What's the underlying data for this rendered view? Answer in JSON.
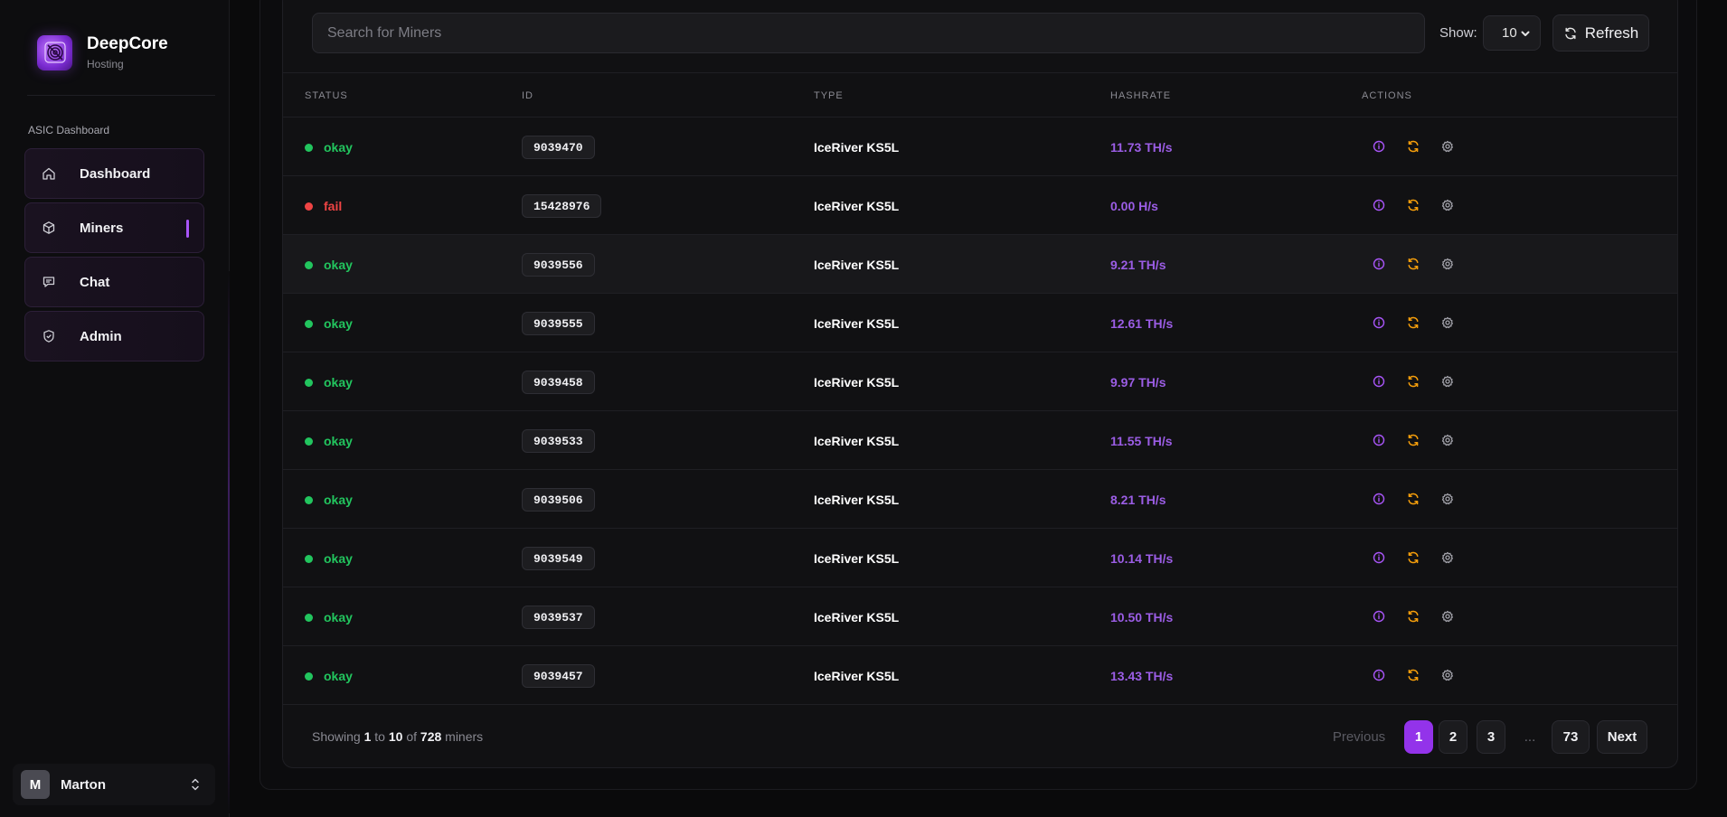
{
  "brand": {
    "name": "DeepCore",
    "subtitle": "Hosting"
  },
  "sidebar": {
    "section_label": "ASIC Dashboard",
    "items": [
      {
        "label": "Dashboard",
        "icon": "home-icon"
      },
      {
        "label": "Miners",
        "icon": "cube-icon",
        "active": true
      },
      {
        "label": "Chat",
        "icon": "chat-icon"
      },
      {
        "label": "Admin",
        "icon": "shield-icon"
      }
    ],
    "user": {
      "initial": "M",
      "name": "Marton"
    }
  },
  "toolbar": {
    "search_placeholder": "Search for Miners",
    "show_label": "Show:",
    "show_value": "10",
    "refresh_label": "Refresh"
  },
  "table": {
    "headers": {
      "status": "STATUS",
      "id": "ID",
      "type": "TYPE",
      "hashrate": "HASHRATE",
      "actions": "ACTIONS"
    },
    "rows": [
      {
        "status": "okay",
        "id": "9039470",
        "type": "IceRiver KS5L",
        "hashrate": "11.73 TH/s"
      },
      {
        "status": "fail",
        "id": "15428976",
        "type": "IceRiver KS5L",
        "hashrate": "0.00 H/s"
      },
      {
        "status": "okay",
        "id": "9039556",
        "type": "IceRiver KS5L",
        "hashrate": "9.21 TH/s"
      },
      {
        "status": "okay",
        "id": "9039555",
        "type": "IceRiver KS5L",
        "hashrate": "12.61 TH/s"
      },
      {
        "status": "okay",
        "id": "9039458",
        "type": "IceRiver KS5L",
        "hashrate": "9.97 TH/s"
      },
      {
        "status": "okay",
        "id": "9039533",
        "type": "IceRiver KS5L",
        "hashrate": "11.55 TH/s"
      },
      {
        "status": "okay",
        "id": "9039506",
        "type": "IceRiver KS5L",
        "hashrate": "8.21 TH/s"
      },
      {
        "status": "okay",
        "id": "9039549",
        "type": "IceRiver KS5L",
        "hashrate": "10.14 TH/s"
      },
      {
        "status": "okay",
        "id": "9039537",
        "type": "IceRiver KS5L",
        "hashrate": "10.50 TH/s"
      },
      {
        "status": "okay",
        "id": "9039457",
        "type": "IceRiver KS5L",
        "hashrate": "13.43 TH/s"
      }
    ]
  },
  "footer": {
    "showing_prefix": "Showing ",
    "from": "1",
    "to_word": " to ",
    "to": "10",
    "of_word": " of ",
    "total": "728",
    "suffix": " miners"
  },
  "pagination": {
    "previous": "Previous",
    "pages": [
      "1",
      "2",
      "3"
    ],
    "ellipsis": "...",
    "last": "73",
    "next": "Next",
    "current": "1"
  },
  "colors": {
    "accent": "#9333ea",
    "okay": "#22c55e",
    "fail": "#ef4444",
    "hashrate": "#9b5de5",
    "info_icon": "#a855f7",
    "restart_icon": "#f59e0b",
    "settings_icon": "#a3a3ab"
  }
}
